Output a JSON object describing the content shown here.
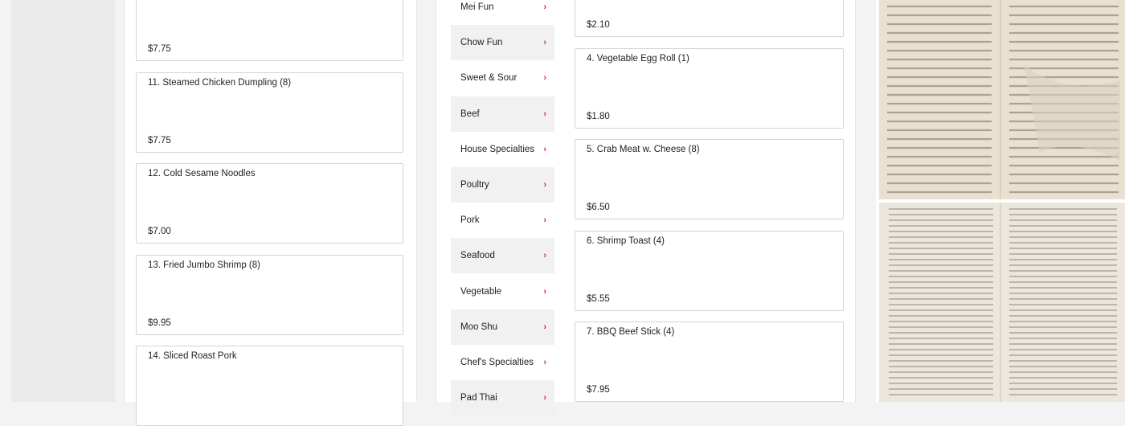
{
  "left_items": [
    {
      "name": "",
      "price": "$7.75"
    },
    {
      "name": "11. Steamed Chicken Dumpling (8)",
      "price": "$7.75"
    },
    {
      "name": "12. Cold Sesame Noodles",
      "price": "$7.00"
    },
    {
      "name": "13. Fried Jumbo Shrimp (8)",
      "price": "$9.95"
    },
    {
      "name": "14. Sliced Roast Pork",
      "price": ""
    }
  ],
  "categories": [
    {
      "label": "Mei Fun"
    },
    {
      "label": "Chow Fun"
    },
    {
      "label": "Sweet & Sour"
    },
    {
      "label": "Beef"
    },
    {
      "label": "House Specialties"
    },
    {
      "label": "Poultry"
    },
    {
      "label": "Pork"
    },
    {
      "label": "Seafood"
    },
    {
      "label": "Vegetable"
    },
    {
      "label": "Moo Shu"
    },
    {
      "label": "Chef's Specialties"
    },
    {
      "label": "Pad Thai"
    }
  ],
  "chevron_icon": "chevron-right-icon",
  "right_items": [
    {
      "name": "",
      "price": "$2.10"
    },
    {
      "name": "4. Vegetable Egg Roll (1)",
      "price": "$1.80"
    },
    {
      "name": "5. Crab Meat w. Cheese (8)",
      "price": "$6.50"
    },
    {
      "name": "6. Shrimp Toast (4)",
      "price": "$5.55"
    },
    {
      "name": "7. BBQ Beef Stick (4)",
      "price": "$7.95"
    }
  ],
  "menu_images": [
    "menu-photo-1",
    "menu-photo-2"
  ],
  "colors": {
    "chevron": "#c0392b",
    "paper": "#e9e2d3"
  }
}
